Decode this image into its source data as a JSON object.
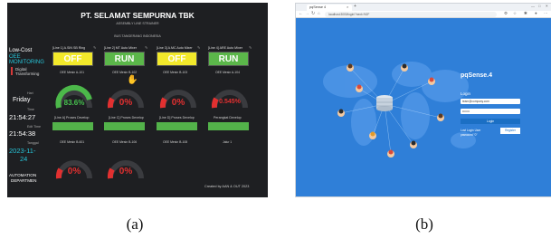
{
  "captions": {
    "a": "(a)",
    "b": "(b)"
  },
  "panel_a": {
    "company": "PT. SELAMAT SEMPURNA TBK",
    "subtitle_1": "ASSEMBLY LINE STRAINER",
    "subtitle_2": "BUS TANGERANG INDONESIA",
    "sidebar": {
      "brand_line1": "Low-Cost",
      "brand_line2": "OEE",
      "brand_line3": "MONITORING",
      "menu_item_1": "Digital",
      "menu_item_2": "Transforming",
      "hari_label": "Hari",
      "hari_value": "Friday",
      "time_label": "Time",
      "time_value": "21:54:27",
      "edit_time_label": "Edit Time",
      "edit_time_value": "21:54:38",
      "tanggal_label": "Tanggal",
      "tanggal_value_1": "2023-11-",
      "tanggal_value_2": "24",
      "footer_1": "AUTOMATION",
      "footer_2": "DEPARTMEN"
    },
    "tiles": [
      {
        "label": "[Line 1] A.SIN SB Ring",
        "state": "OFF"
      },
      {
        "label": "[Line 2] MT Auto Mixer",
        "state": "RUN"
      },
      {
        "label": "[Line 3] A.MC Auto Mixer",
        "state": "OFF"
      },
      {
        "label": "[Line 4] ARE Auto Mixer",
        "state": "RUN"
      }
    ],
    "gauges_row1": [
      {
        "label": "OEE Mesin A-101",
        "value": "83.6%"
      },
      {
        "label": "OEE Mesin B-102",
        "value": "0%"
      },
      {
        "label": "OEE Mesin B-103",
        "value": "0%"
      },
      {
        "label": "OEE Mesin A-104",
        "value": "0.545%"
      }
    ],
    "bars": [
      {
        "label": "[Line A] Proses Develop"
      },
      {
        "label": "[Line C] Proses Develop"
      },
      {
        "label": "[Line D] Proses Develop"
      },
      {
        "label": "Perangkat Develop"
      }
    ],
    "gauges_row2": [
      {
        "label": "OEE Mesin B-601",
        "value": "0%"
      },
      {
        "label": "OEE Mesin B-106",
        "value": "0%"
      },
      {
        "label": "OEE Mesin B-108",
        "value": ""
      },
      {
        "label": "Jalur 1",
        "value": ""
      }
    ],
    "footer_credit": "Created by AAN & OUT 2023",
    "colors": {
      "off": "#f2e92b",
      "run": "#5bb74a",
      "alarm": "#e23030",
      "accent": "#27c4d8"
    }
  },
  "panel_b": {
    "tab_title": "pqSense 4",
    "address": "localhost:3000/login/?next=%2F",
    "app_title": "pqSense.4",
    "login_heading": "Login",
    "username_value": "team@company.com",
    "password_value": "•••••••",
    "login_button": "Login",
    "forgot_line1": "Lost Login User",
    "forgot_line2": "password \"0\"",
    "register_button": "Register",
    "colors": {
      "background": "#2f7fd8",
      "button": "#1b6fc4"
    }
  }
}
